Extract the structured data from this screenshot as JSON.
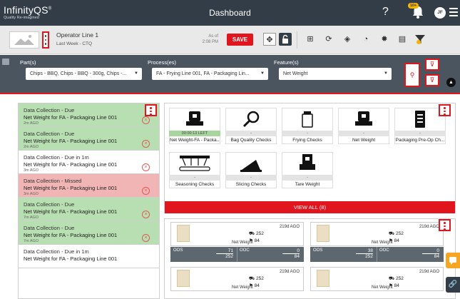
{
  "app": {
    "brand": "InfinityQS",
    "brand_mark": "®",
    "tagline": "Quality Re-imagined",
    "title": "Dashboard",
    "help": "?",
    "notification_count": "10+",
    "user_initials": "JF"
  },
  "header": {
    "line_name": "Operator Line 1",
    "range": "Last Week - CTQ",
    "as_of_label": "As of",
    "as_of_time": "2:08 PM",
    "save_label": "SAVE"
  },
  "filters": [
    {
      "label": "Part(s)",
      "value": "Chips - BBQ, Chips - BBQ - 300g, Chips -..."
    },
    {
      "label": "Process(es)",
      "value": "FA - Frying Line 001, FA - Packaging Lin..."
    },
    {
      "label": "Feature(s)",
      "value": "Net Weight"
    }
  ],
  "tasks": [
    {
      "status": "Data Collection - Due",
      "name": "Net Weight for FA - Packaging Line 001",
      "ago": "2m AGO",
      "color": "green"
    },
    {
      "status": "Data Collection - Due",
      "name": "Net Weight for FA - Packaging Line 001",
      "ago": "2m AGO",
      "color": "green"
    },
    {
      "status": "Data Collection - Due in 1m",
      "name": "Net Weight for FA - Packaging Line 001",
      "ago": "3m AGO",
      "color": "white"
    },
    {
      "status": "Data Collection - Missed",
      "name": "Net Weight for FA - Packaging Line 001",
      "ago": "3m AGO",
      "color": "red"
    },
    {
      "status": "Data Collection - Due",
      "name": "Net Weight for FA - Packaging Line 001",
      "ago": "7m AGO",
      "color": "green"
    },
    {
      "status": "Data Collection - Due",
      "name": "Net Weight for FA - Packaging Line 001",
      "ago": "7m AGO",
      "color": "green"
    },
    {
      "status": "Data Collection - Due in 1m",
      "name": "Net Weight for FA - Packaging Line 001",
      "ago": "",
      "color": "white"
    }
  ],
  "checks": [
    {
      "label": "Net Weight-FA - Packa...",
      "status": "00:00:13 LEFT",
      "icon": "scale-bag-icon"
    },
    {
      "label": "Bag Quality Checks",
      "status": "-",
      "icon": "magnifier-bag-icon"
    },
    {
      "label": "Frying Checks",
      "status": "-",
      "icon": "fryer-icon"
    },
    {
      "label": "Net Weight",
      "status": "-",
      "icon": "scale-bag-icon"
    },
    {
      "label": "Packaging Pre-Op Ch...",
      "status": "-",
      "icon": "clipboard-icon"
    },
    {
      "label": "Seasoning Checks",
      "status": "-",
      "icon": "seasoning-icon"
    },
    {
      "label": "Slicing Checks",
      "status": "-",
      "icon": "slicer-icon"
    },
    {
      "label": "Tare Weight",
      "status": "-",
      "icon": "tare-scale-icon"
    }
  ],
  "view_all_label": "VIEW ALL (8)",
  "products": [
    {
      "ago": "219d AGO",
      "count1": "252",
      "count2": "84",
      "feature": "Net Weight",
      "oos_label": "OOS",
      "oos_num": "71",
      "oos_den": "252",
      "ooc_label": "OOC",
      "ooc_num": "0",
      "ooc_den": "84"
    },
    {
      "ago": "219d AGO",
      "count1": "252",
      "count2": "84",
      "feature": "Net Weight",
      "oos_label": "OOS",
      "oos_num": "38",
      "oos_den": "252",
      "ooc_label": "OOC",
      "ooc_num": "0",
      "ooc_den": "84"
    },
    {
      "ago": "219d AGO",
      "count1": "252",
      "count2": "84",
      "feature": "Net Weight"
    },
    {
      "ago": "219d AGO",
      "count1": "252",
      "count2": "84",
      "feature": "Net Weight"
    }
  ],
  "colors": {
    "accent": "#e0151e",
    "topbar": "#333d48",
    "filterbar": "#4a5560",
    "green": "#b8dfb1",
    "red": "#f2b5b5"
  }
}
